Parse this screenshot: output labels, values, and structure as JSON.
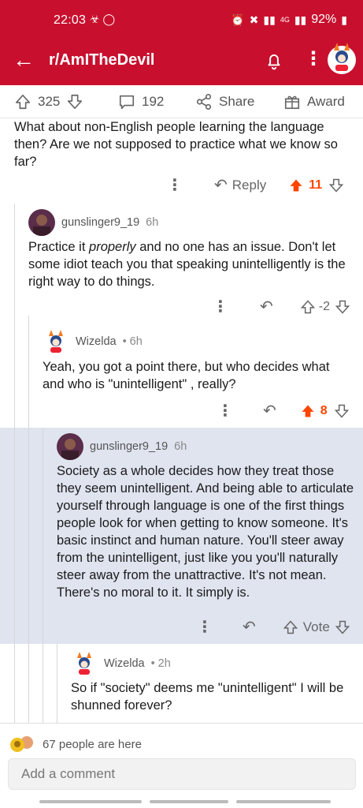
{
  "status": {
    "time": "22:03",
    "network": "4G",
    "battery": "92%"
  },
  "appbar": {
    "title": "r/AmITheDevil"
  },
  "actions": {
    "upvotes": "325",
    "comments": "192",
    "share": "Share",
    "award": "Award"
  },
  "comments": [
    {
      "text": "What about non-English people learning the language then? Are we not supposed to practice what we know so far?",
      "reply": "Reply",
      "score": "11"
    },
    {
      "author": "gunslinger9_19",
      "time": "6h",
      "text_before": "Practice it ",
      "text_em": "properly",
      "text_after": " and no one has an issue. Don't let some idiot teach you that speaking unintelligently is the right way to do things.",
      "score": "-2"
    },
    {
      "author": "Wizelda",
      "time": "6h",
      "text": "Yeah, you got a point there, but who decides what and who is \"unintelligent\" , really?",
      "score": "8"
    },
    {
      "author": "gunslinger9_19",
      "time": "6h",
      "text": "Society as a whole decides how they treat those they seem unintelligent. And being able to articulate yourself through language is one of the first things people look for when getting to know someone. It's basic instinct and human nature. You'll steer away from the unintelligent, just like you you'll naturally steer away from the unattractive. It's not mean. There's no moral to it. It simply is.",
      "score": "Vote"
    },
    {
      "author": "Wizelda",
      "time": "2h",
      "text": "So if \"society\" deems me \"unintelligent\" I will be shunned forever?"
    }
  ],
  "bottom": {
    "presence": "67 people are here",
    "placeholder": "Add a comment"
  },
  "colors": {
    "brand": "#c8102e",
    "upvote": "#ff4500",
    "highlight": "#dfe4ef"
  }
}
